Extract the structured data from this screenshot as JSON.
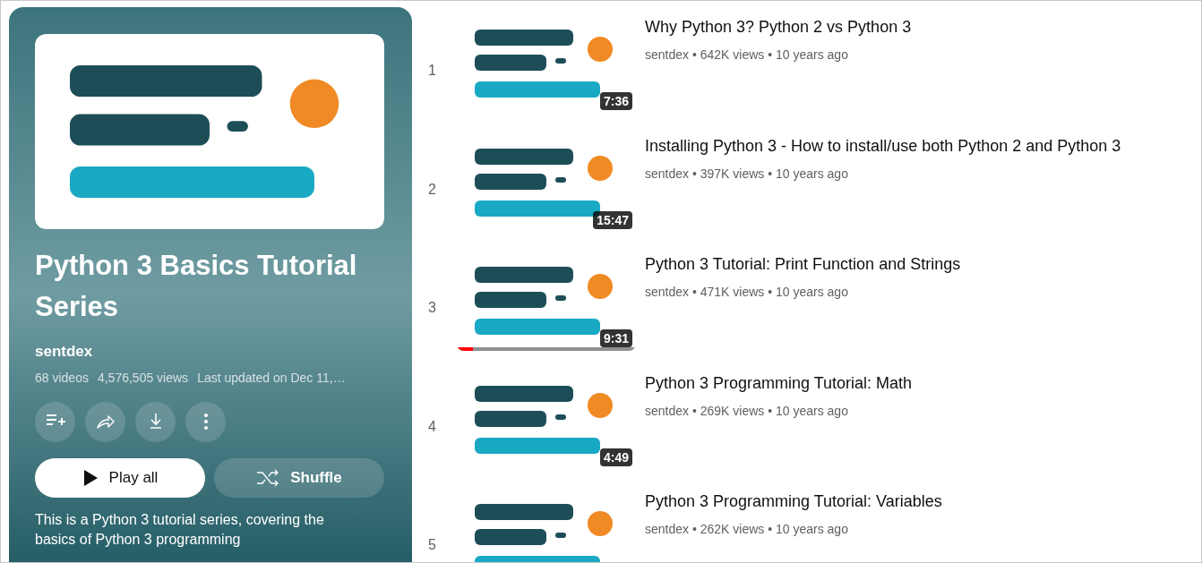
{
  "playlist": {
    "title": "Python 3 Basics Tutorial Series",
    "channel": "sentdex",
    "stats": [
      "68 videos",
      "4,576,505 views",
      "Last updated on Dec 11,…"
    ],
    "actions": [
      {
        "kind": "save"
      },
      {
        "kind": "share"
      },
      {
        "kind": "download"
      },
      {
        "kind": "more"
      }
    ],
    "buttons": [
      {
        "kind": "play",
        "label": "Play all"
      },
      {
        "kind": "shuffle",
        "label": "Shuffle"
      }
    ],
    "description": "This is a Python 3 tutorial series, covering the basics of Python 3 programming"
  },
  "videos": [
    {
      "index": "1",
      "title": "Why Python 3? Python 2 vs Python 3",
      "meta": "sentdex • 642K views • 10 years ago",
      "duration": "7:36"
    },
    {
      "index": "2",
      "title": "Installing Python 3 - How to install/use both Python 2 and Python 3",
      "meta": "sentdex • 397K views • 10 years ago",
      "duration": "15:47"
    },
    {
      "index": "3",
      "title": "Python 3 Tutorial: Print Function and Strings",
      "meta": "sentdex • 471K views • 10 years ago",
      "duration": "9:31",
      "watch_progress": {
        "level": 0.09
      }
    },
    {
      "index": "4",
      "title": "Python 3 Programming Tutorial: Math",
      "meta": "sentdex • 269K views • 10 years ago",
      "duration": "4:49"
    },
    {
      "index": "5",
      "title": "Python 3 Programming Tutorial: Variables",
      "meta": "sentdex • 262K views • 10 years ago"
    }
  ]
}
